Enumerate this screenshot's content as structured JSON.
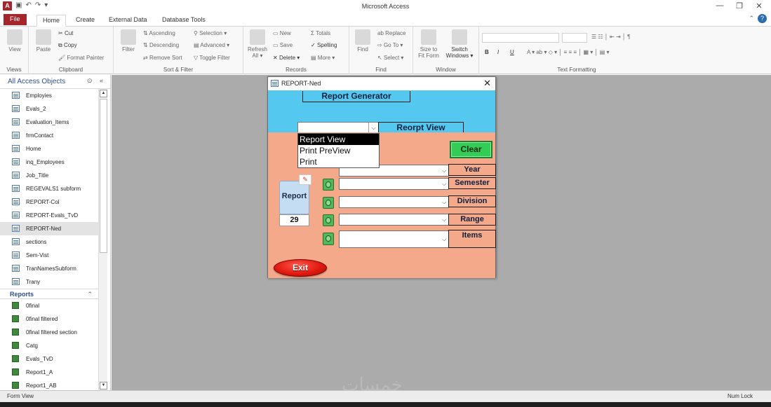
{
  "window": {
    "title": "Microsoft Access",
    "app_icon": "A"
  },
  "tabs": [
    {
      "label": "File"
    },
    {
      "label": "Home"
    },
    {
      "label": "Create"
    },
    {
      "label": "External Data"
    },
    {
      "label": "Database Tools"
    }
  ],
  "ribbon": {
    "views": {
      "view_label": "View",
      "group": "Views"
    },
    "clipboard": {
      "paste": "Paste",
      "cut": "Cut",
      "copy": "Copy",
      "format_painter": "Format Painter",
      "group": "Clipboard"
    },
    "sort_filter": {
      "filter": "Filter",
      "ascending": "Ascending",
      "descending": "Descending",
      "remove_sort": "Remove Sort",
      "selection": "Selection",
      "advanced": "Advanced",
      "toggle_filter": "Toggle Filter",
      "group": "Sort & Filter"
    },
    "records": {
      "refresh": "Refresh",
      "refresh_all": "All",
      "new": "New",
      "save": "Save",
      "delete": "Delete",
      "totals": "Totals",
      "spelling": "Spelling",
      "more": "More",
      "group": "Records"
    },
    "find": {
      "find": "Find",
      "replace": "Replace",
      "goto": "Go To",
      "select": "Select",
      "group": "Find"
    },
    "window": {
      "size_to": "Size to",
      "fit_form": "Fit Form",
      "switch": "Switch",
      "windows": "Windows",
      "group": "Window"
    },
    "text_formatting": {
      "group": "Text Formatting"
    }
  },
  "navpane": {
    "title": "All Access Objects",
    "forms": [
      "Employies",
      "Evals_2",
      "Evaluation_Items",
      "frmContact",
      "Home",
      "inq_Employees",
      "Job_Title",
      "REGEVALS1 subform",
      "REPORT-Col",
      "REPORT-Evals_TvD",
      "REPORT-Ned",
      "sections",
      "Sem-Vist",
      "TranNamesSubform",
      "Trany"
    ],
    "selected": "REPORT-Ned",
    "reports_section": "Reports",
    "reports": [
      "0final",
      "0final filtered",
      "0final filtered section",
      "Catg",
      "Evals_TvD",
      "Report1_A",
      "Report1_AB"
    ]
  },
  "form": {
    "window_title": "REPORT-Ned",
    "header_title": "Report Generator",
    "view_combo_value": "",
    "view_label": "Reorpt View",
    "dropdown_options": [
      "Report View",
      "Print PreView",
      "Print"
    ],
    "selected_option": "Report View",
    "clear_label": "Clear",
    "report_label": "Report",
    "report_count": "29",
    "criteria": [
      {
        "label": "Year"
      },
      {
        "label": "Semester"
      },
      {
        "label": "Division"
      },
      {
        "label": "Range"
      },
      {
        "label": "Items"
      }
    ],
    "exit_label": "Exit"
  },
  "statusbar": {
    "left": "Form View",
    "right": "Num Lock"
  },
  "colors": {
    "header_bg": "#54c8ee",
    "body_bg": "#f4a98b",
    "clear_btn": "#33cc55",
    "exit_btn": "#e11a10",
    "file_tab": "#a4262c"
  }
}
